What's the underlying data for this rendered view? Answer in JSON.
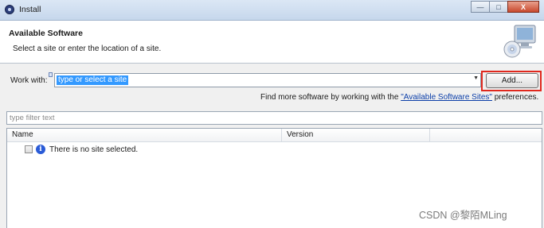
{
  "window": {
    "title": "Install",
    "buttons": {
      "minimize": "—",
      "maximize": "□",
      "close": "X"
    }
  },
  "header": {
    "title": "Available Software",
    "subtitle": "Select a site or enter the location of a site.",
    "icon": "cd-monitor-icon"
  },
  "work_with": {
    "label": "Work with:",
    "value": "type or select a site",
    "add_label": "Add...",
    "dropdown_icon": "dropdown-arrow-icon"
  },
  "find_more": {
    "prefix": "Find more software by working with the ",
    "link": "\"Available Software Sites\"",
    "suffix": " preferences."
  },
  "filter": {
    "placeholder": "type filter text"
  },
  "table": {
    "columns": [
      "Name",
      "Version"
    ],
    "rows": [
      {
        "checked": false,
        "icon": "info-icon",
        "info_glyph": "i",
        "text": "There is no site selected."
      }
    ]
  },
  "watermark": "CSDN @黎陌MLing",
  "colors": {
    "selection": "#3399ff",
    "link": "#0b3ea8",
    "highlight_border": "#e0281d"
  }
}
